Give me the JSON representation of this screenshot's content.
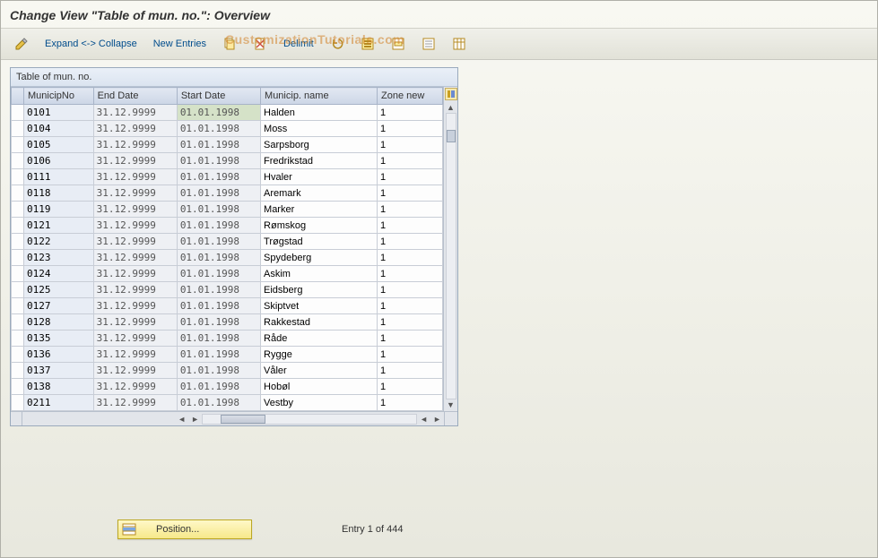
{
  "header": {
    "title": "Change View \"Table of mun. no.\": Overview"
  },
  "toolbar": {
    "expand_collapse": "Expand <-> Collapse",
    "new_entries": "New Entries",
    "delimit": "Delimit"
  },
  "watermark": "CustomizationTutorials.com",
  "panel": {
    "title": "Table of mun. no.",
    "columns": [
      "MunicipNo",
      "End Date",
      "Start Date",
      "Municip. name",
      "Zone new"
    ]
  },
  "rows": [
    {
      "no": "0101",
      "end": "31.12.9999",
      "start": "01.01.1998",
      "name": "Halden",
      "zone": "1"
    },
    {
      "no": "0104",
      "end": "31.12.9999",
      "start": "01.01.1998",
      "name": "Moss",
      "zone": "1"
    },
    {
      "no": "0105",
      "end": "31.12.9999",
      "start": "01.01.1998",
      "name": "Sarpsborg",
      "zone": "1"
    },
    {
      "no": "0106",
      "end": "31.12.9999",
      "start": "01.01.1998",
      "name": "Fredrikstad",
      "zone": "1"
    },
    {
      "no": "0111",
      "end": "31.12.9999",
      "start": "01.01.1998",
      "name": "Hvaler",
      "zone": "1"
    },
    {
      "no": "0118",
      "end": "31.12.9999",
      "start": "01.01.1998",
      "name": "Aremark",
      "zone": "1"
    },
    {
      "no": "0119",
      "end": "31.12.9999",
      "start": "01.01.1998",
      "name": "Marker",
      "zone": "1"
    },
    {
      "no": "0121",
      "end": "31.12.9999",
      "start": "01.01.1998",
      "name": "Rømskog",
      "zone": "1"
    },
    {
      "no": "0122",
      "end": "31.12.9999",
      "start": "01.01.1998",
      "name": "Trøgstad",
      "zone": "1"
    },
    {
      "no": "0123",
      "end": "31.12.9999",
      "start": "01.01.1998",
      "name": "Spydeberg",
      "zone": "1"
    },
    {
      "no": "0124",
      "end": "31.12.9999",
      "start": "01.01.1998",
      "name": "Askim",
      "zone": "1"
    },
    {
      "no": "0125",
      "end": "31.12.9999",
      "start": "01.01.1998",
      "name": "Eidsberg",
      "zone": "1"
    },
    {
      "no": "0127",
      "end": "31.12.9999",
      "start": "01.01.1998",
      "name": "Skiptvet",
      "zone": "1"
    },
    {
      "no": "0128",
      "end": "31.12.9999",
      "start": "01.01.1998",
      "name": "Rakkestad",
      "zone": "1"
    },
    {
      "no": "0135",
      "end": "31.12.9999",
      "start": "01.01.1998",
      "name": "Råde",
      "zone": "1"
    },
    {
      "no": "0136",
      "end": "31.12.9999",
      "start": "01.01.1998",
      "name": "Rygge",
      "zone": "1"
    },
    {
      "no": "0137",
      "end": "31.12.9999",
      "start": "01.01.1998",
      "name": "Våler",
      "zone": "1"
    },
    {
      "no": "0138",
      "end": "31.12.9999",
      "start": "01.01.1998",
      "name": "Hobøl",
      "zone": "1"
    },
    {
      "no": "0211",
      "end": "31.12.9999",
      "start": "01.01.1998",
      "name": "Vestby",
      "zone": "1"
    }
  ],
  "footer": {
    "position_label": "Position...",
    "entry_info": "Entry 1 of 444"
  },
  "icons": {
    "pencil": "pencil-icon",
    "copy": "copy-icon",
    "doc": "doc-icon",
    "delete": "delete-icon",
    "select": "select-icon",
    "block": "block-icon",
    "deselect": "deselect-icon",
    "config": "config-icon"
  }
}
